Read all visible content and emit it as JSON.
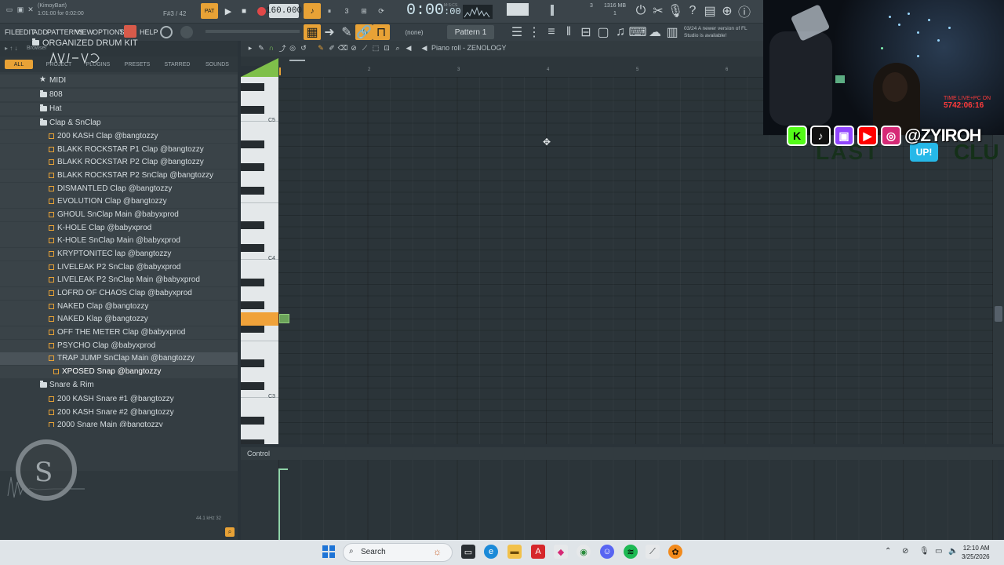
{
  "topbar": {
    "song_name": "(KimoyBart)",
    "song_time": "1:01:00 for 0:02:00",
    "step_value": "F#3 / 42",
    "pattern_mode": "PAT",
    "tempo": "160.000",
    "time_display": "0:00",
    "time_small": ":00",
    "time_unit": "M:S:CS",
    "memory": "1316 MB",
    "cpu_num": "3",
    "voices": "1",
    "new_version": "03/24 A newer version of FL Studio is available!"
  },
  "menu": {
    "items": [
      "FILE",
      "EDIT",
      "ADD",
      "PATTERNS",
      "VIEW",
      "OPTIONS",
      "T",
      "HELP"
    ],
    "none_select": "(none)",
    "pattern": "Pattern 1"
  },
  "browser": {
    "header": "Browser",
    "tabs": [
      "ALL",
      "PROJECT",
      "PLUGINS",
      "PRESETS",
      "STARRED",
      "SOUNDS"
    ],
    "folder_root": "ORGANIZED DRUM KIT",
    "folders": [
      "MIDI",
      "808",
      "Hat",
      "Clap & SnClap"
    ],
    "files": [
      "200 KASH Clap @bangtozzy",
      "BLAKK ROCKSTAR P1 Clap @bangtozzy",
      "BLAKK ROCKSTAR P2 Clap @bangtozzy",
      "BLAKK ROCKSTAR P2 SnClap @bangtozzy",
      "DISMANTLED Clap @bangtozzy",
      "EVOLUTION Clap @bangtozzy",
      "GHOUL SnClap Main @babyxprod",
      "K-HOLE Clap @babyxprod",
      "K-HOLE SnClap Main @babyxprod",
      "KRYPTONITEC lap @bangtozzy",
      "LIVELEAK P2 SnClap @babyxprod",
      "LIVELEAK P2 SnClap Main @babyxprod",
      "LOFRD OF CHAOS Clap @babyxprod",
      "NAKED Clap @bangtozzy",
      "NAKED Klap @bangtozzy",
      "OFF THE METER Clap @babyxprod",
      "PSYCHO Clap @babyxprod",
      "TRAP JUMP SnClap Main @bangtozzy",
      "XPOSED Snap @bangtozzy"
    ],
    "snare_folder": "Snare & Rim",
    "snare_files": [
      "200 KASH Snare #1 @bangtozzy",
      "200 KASH Snare #2 @bangtozzy",
      "2000 Snare Main @bangtozzy"
    ],
    "sample_rate": "44.1 kHz 32"
  },
  "pianoroll": {
    "title": "Piano roll - ZENOLOGY",
    "ruler": [
      "2",
      "3",
      "4",
      "5",
      "6"
    ],
    "key_labels": [
      "C5",
      "C4",
      "C3"
    ],
    "control_label": "Control"
  },
  "overlay": {
    "time_live_label": "TIME LIVE+PC ON",
    "time_live_value": "5742:06:16",
    "social_name": "@ZYIROH",
    "banner_left": "LAST",
    "banner_badge": "UP!",
    "banner_right": "CLU"
  },
  "taskbar": {
    "search_placeholder": "Search",
    "time": "12:10 AM",
    "date": "3/25/2026"
  }
}
